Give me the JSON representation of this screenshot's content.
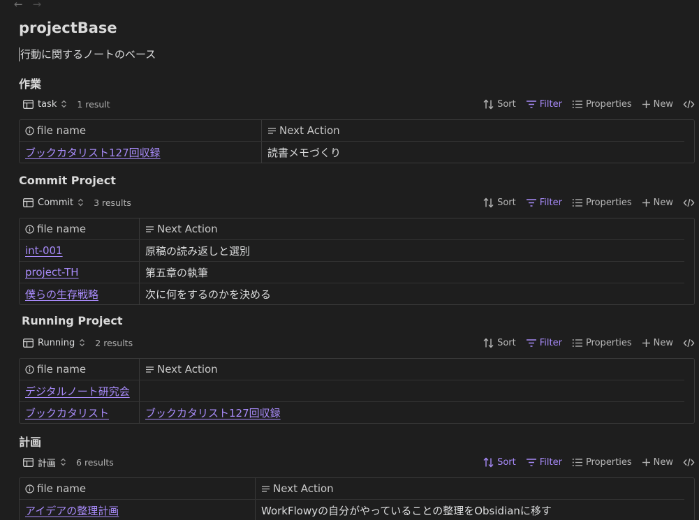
{
  "page": {
    "title": "projectBase",
    "subtitle": "行動に関するノートのベース"
  },
  "toolbar_labels": {
    "sort": "Sort",
    "filter": "Filter",
    "properties": "Properties",
    "new": "New"
  },
  "columns": {
    "file_name": "file name",
    "next_action": "Next Action"
  },
  "sections": [
    {
      "heading": "作業",
      "view": "task",
      "count": "1 result",
      "sort_active": false,
      "rows": [
        {
          "file": "ブックカタリスト127回収録",
          "action": "読書メモづくり",
          "action_is_link": false
        }
      ]
    },
    {
      "heading": "Commit Project",
      "view": "Commit",
      "count": "3 results",
      "sort_active": false,
      "rows": [
        {
          "file": "int-001",
          "action": "原稿の読み返しと選別",
          "action_is_link": false
        },
        {
          "file": "project-TH",
          "action": "第五章の執筆",
          "action_is_link": false
        },
        {
          "file": "僕らの生存戦略",
          "action": "次に何をするのかを決める",
          "action_is_link": false
        }
      ]
    },
    {
      "heading": "Running Project",
      "view": "Running",
      "count": "2 results",
      "sort_active": false,
      "rows": [
        {
          "file": "デジタルノート研究会",
          "action": "",
          "action_is_link": false
        },
        {
          "file": "ブックカタリスト",
          "action": "ブックカタリスト127回収録",
          "action_is_link": true
        }
      ]
    },
    {
      "heading": "計画",
      "view": "計画",
      "count": "6 results",
      "sort_active": true,
      "rows": [
        {
          "file": "アイデアの整理計画",
          "action": "WorkFlowyの自分がやっていることの整理をObsidianに移す",
          "action_is_link": false
        }
      ]
    }
  ],
  "colors": {
    "background": "#1e1e1e",
    "accent": "#a88bfa",
    "text": "#dcddde"
  },
  "icons": [
    "back-arrow-icon",
    "forward-arrow-icon",
    "table-icon",
    "chevron-updown-icon",
    "sort-icon",
    "filter-icon",
    "list-icon",
    "plus-icon",
    "code-icon",
    "info-icon",
    "lines-icon"
  ]
}
